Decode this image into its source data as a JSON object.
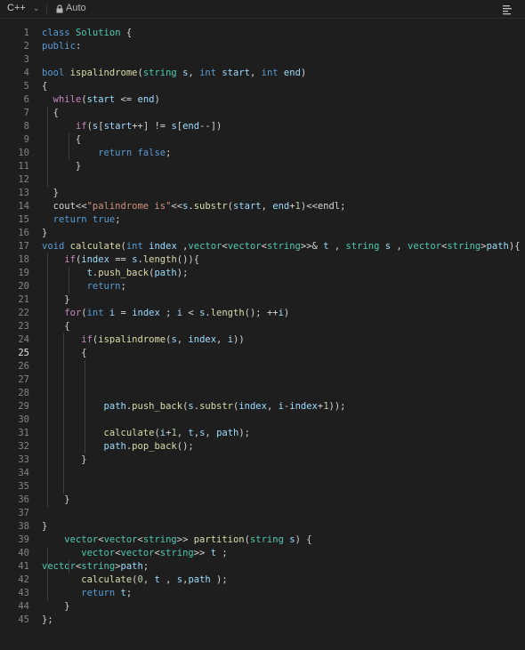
{
  "toolbar": {
    "language": "C++",
    "mode": "Auto",
    "icons": [
      "chevron-down-icon",
      "lock-icon",
      "format-icon"
    ]
  },
  "active_line": 25,
  "lines": [
    {
      "n": "1",
      "code": "class Solution {"
    },
    {
      "n": "2",
      "code": "public:"
    },
    {
      "n": "3",
      "code": ""
    },
    {
      "n": "4",
      "code": "bool ispalindrome(string s, int start, int end)"
    },
    {
      "n": "5",
      "code": "{"
    },
    {
      "n": "6",
      "code": "  while(start <= end)"
    },
    {
      "n": "7",
      "code": "  {"
    },
    {
      "n": "8",
      "code": "      if(s[start++] != s[end--])"
    },
    {
      "n": "9",
      "code": "      {"
    },
    {
      "n": "10",
      "code": "          return false;"
    },
    {
      "n": "11",
      "code": "      }"
    },
    {
      "n": "12",
      "code": ""
    },
    {
      "n": "13",
      "code": "  }"
    },
    {
      "n": "14",
      "code": "  cout<<\"palindrome is\"<<s.substr(start, end+1)<<endl;"
    },
    {
      "n": "15",
      "code": "  return true;"
    },
    {
      "n": "16",
      "code": "}"
    },
    {
      "n": "17",
      "code": "void calculate(int index ,vector<vector<string>>& t , string s , vector<string>path){"
    },
    {
      "n": "18",
      "code": "    if(index == s.length()){"
    },
    {
      "n": "19",
      "code": "        t.push_back(path);"
    },
    {
      "n": "20",
      "code": "        return;"
    },
    {
      "n": "21",
      "code": "    }"
    },
    {
      "n": "22",
      "code": "    for(int i = index ; i < s.length(); ++i)"
    },
    {
      "n": "23",
      "code": "    {"
    },
    {
      "n": "24",
      "code": "       if(ispalindrome(s, index, i))"
    },
    {
      "n": "25",
      "code": "       {"
    },
    {
      "n": "26",
      "code": ""
    },
    {
      "n": "27",
      "code": ""
    },
    {
      "n": "28",
      "code": ""
    },
    {
      "n": "29",
      "code": "           path.push_back(s.substr(index, i-index+1));"
    },
    {
      "n": "30",
      "code": ""
    },
    {
      "n": "31",
      "code": "           calculate(i+1, t,s, path);"
    },
    {
      "n": "32",
      "code": "           path.pop_back();"
    },
    {
      "n": "33",
      "code": "       }"
    },
    {
      "n": "34",
      "code": ""
    },
    {
      "n": "35",
      "code": ""
    },
    {
      "n": "36",
      "code": "    }"
    },
    {
      "n": "37",
      "code": ""
    },
    {
      "n": "38",
      "code": "}"
    },
    {
      "n": "39",
      "code": "    vector<vector<string>> partition(string s) {"
    },
    {
      "n": "40",
      "code": "       vector<vector<string>> t ;"
    },
    {
      "n": "41",
      "code": "vector<string>path;"
    },
    {
      "n": "42",
      "code": "       calculate(0, t , s,path );"
    },
    {
      "n": "43",
      "code": "       return t;"
    },
    {
      "n": "44",
      "code": "    }"
    },
    {
      "n": "45",
      "code": "};"
    }
  ]
}
